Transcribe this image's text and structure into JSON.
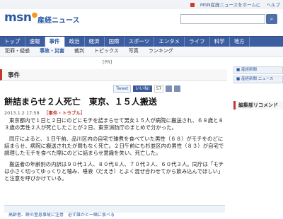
{
  "topbar": {
    "links": [
      "MSN産経ニュースをホームに",
      "ヘルプ"
    ]
  },
  "brand": {
    "logo": "msn",
    "sub": "産経ニュース"
  },
  "search": {
    "placeholder": "",
    "button": "検索"
  },
  "nav": {
    "tabs": [
      "トップ",
      "速報",
      "事件",
      "政治",
      "経済",
      "国際",
      "スポーツ",
      "エンタメ",
      "ライフ",
      "科学",
      "地方"
    ],
    "active_index": 2
  },
  "subnav": {
    "items": [
      "犯罪・疑惑",
      "事故・災害",
      "裁判",
      "トピックス",
      "写真",
      "ランキング"
    ],
    "active_index": 1
  },
  "pr": "[PR]",
  "section": {
    "label": "事件"
  },
  "right": {
    "buttons": [
      "■ 産経新聞",
      "■ 産経新聞 ニュース"
    ],
    "recommend": "編集部リコメンド"
  },
  "share": {
    "tweet": "Tweet",
    "fb": "いいね!",
    "count": "57"
  },
  "article": {
    "title": "餅詰まらせ２人死亡　東京、１５人搬送",
    "date": "2013.1.2 17:58",
    "category": "［事件・トラブル］",
    "paragraphs": [
      "東京都内で１日と２日にのどにモチを詰まらせて男女１５人が病院に搬送され、６８歳と８３歳の男性２人が死亡したことが２日、東京消防庁のまとめで分かった。",
      "同庁によると、１日午前、品川区内の自宅で雑煮を食べていた男性（６８）がモチをのどに詰まらせ、病院に搬送されたが間もなく死亡。２日午前にも杉並区内の男性（８３）が自宅で調理したモチを食べた際にのどに詰まらせ意識を失い、死亡した。",
      "搬送者の年齢別の内訳は９０代１人、８０代８人、７０代３人、６０代３人。同庁は「モチは小さく切ってゆっくりと噛み、唾液（だえき）とよく混ぜ合わせてから飲み込んでほしい」と注意を呼びかけている。"
    ]
  },
  "related": {
    "text": "高齢者、餅の窒息事故に注意　必ず誰かと一緒に食べる"
  }
}
